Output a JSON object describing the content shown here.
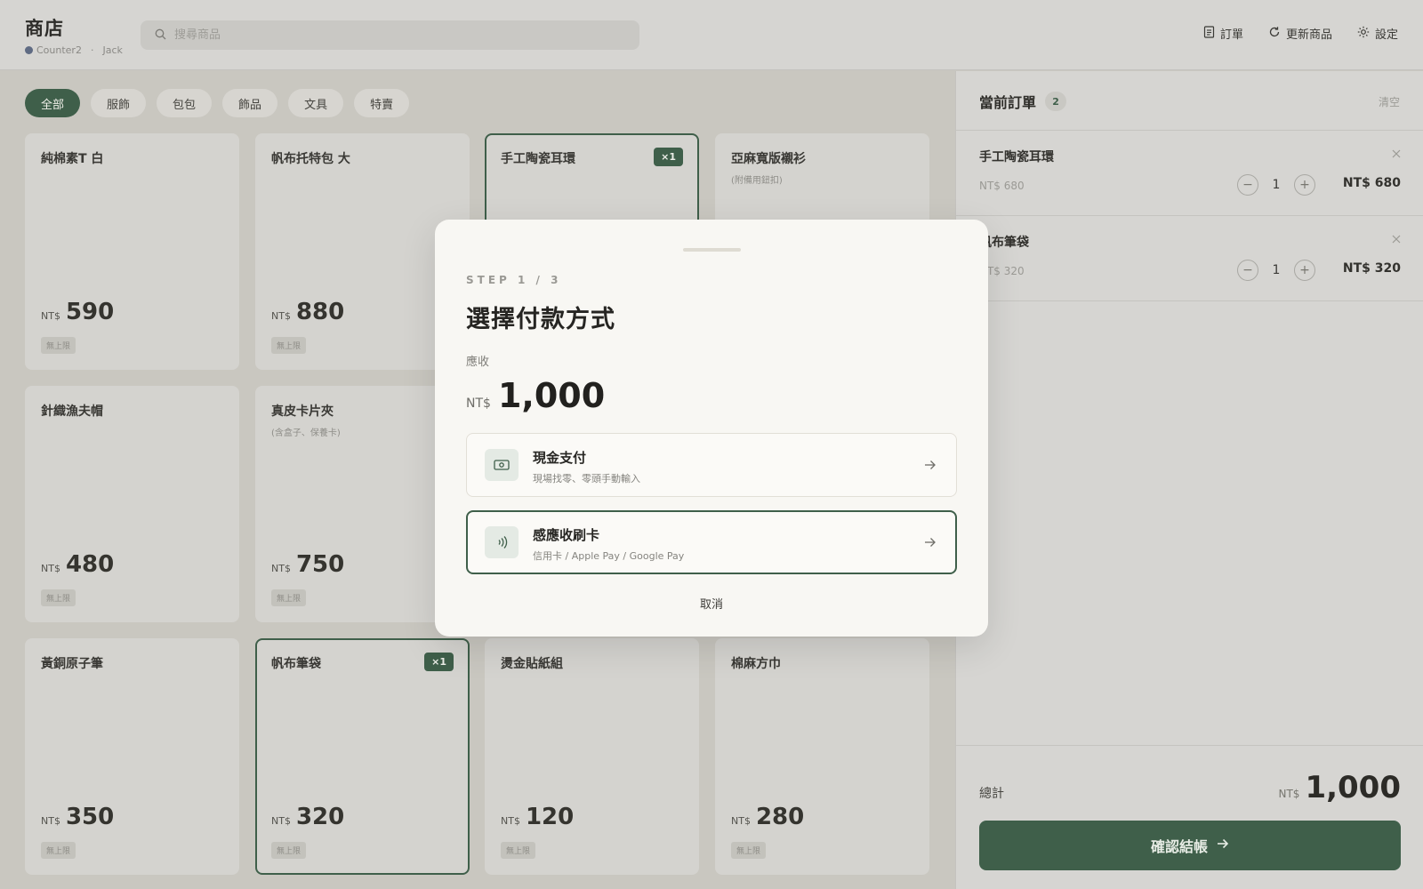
{
  "header": {
    "title": "商店",
    "device": "Counter2",
    "separator": "·",
    "user": "Jack",
    "search_placeholder": "搜尋商品",
    "actions": [
      {
        "label": "訂單",
        "icon": "orders-icon"
      },
      {
        "label": "更新商品",
        "icon": "refresh-icon"
      },
      {
        "label": "設定",
        "icon": "gear-icon"
      }
    ]
  },
  "filters": [
    "全部",
    "服飾",
    "包包",
    "飾品",
    "文具",
    "特賣"
  ],
  "active_filter": "全部",
  "products": [
    {
      "name": "純棉素T 白",
      "note": "",
      "currency": "NT$",
      "price": "590",
      "badge": "無上限",
      "qty": ""
    },
    {
      "name": "帆布托特包 大",
      "note": "",
      "currency": "NT$",
      "price": "880",
      "badge": "無上限",
      "qty": ""
    },
    {
      "name": "手工陶瓷耳環",
      "note": "",
      "currency": "NT$",
      "price": "",
      "badge": "",
      "qty": "×1"
    },
    {
      "name": "亞麻寬版襯衫",
      "note": "(附備用鈕扣)",
      "currency": "NT$",
      "price": "",
      "badge": "",
      "qty": ""
    },
    {
      "name": "針織漁夫帽",
      "note": "",
      "currency": "NT$",
      "price": "480",
      "badge": "無上限",
      "qty": ""
    },
    {
      "name": "真皮卡片夾",
      "note": "(含盒子、保養卡)",
      "currency": "NT$",
      "price": "750",
      "badge": "無上限",
      "qty": ""
    },
    {
      "name": "黃銅原子筆",
      "note": "",
      "currency": "NT$",
      "price": "350",
      "badge": "無上限",
      "qty": ""
    },
    {
      "name": "帆布筆袋",
      "note": "",
      "currency": "NT$",
      "price": "320",
      "badge": "無上限",
      "qty": "×1"
    },
    {
      "name": "燙金貼紙組",
      "note": "",
      "currency": "NT$",
      "price": "120",
      "badge": "無上限",
      "qty": ""
    },
    {
      "name": "棉麻方巾",
      "note": "",
      "currency": "NT$",
      "price": "280",
      "badge": "無上限",
      "qty": ""
    }
  ],
  "order": {
    "title": "當前訂單",
    "count": "2",
    "clear_label": "清空",
    "items": [
      {
        "name": "手工陶瓷耳環",
        "unit": "NT$ 680",
        "qty": "1",
        "total": "NT$ 680"
      },
      {
        "name": "帆布筆袋",
        "unit": "NT$ 320",
        "qty": "1",
        "total": "NT$ 320"
      }
    ],
    "total_label": "總計",
    "total_currency": "NT$",
    "total_amount": "1,000",
    "checkout_label": "確認結帳"
  },
  "modal": {
    "step": "STEP 1 / 3",
    "title": "選擇付款方式",
    "due_label": "應收",
    "due_currency": "NT$",
    "due_amount": "1,000",
    "options": [
      {
        "title": "現金支付",
        "subtitle": "現場找零、零頭手動輸入",
        "icon": "cash-icon"
      },
      {
        "title": "感應收刷卡",
        "subtitle": "信用卡 / Apple Pay / Google Pay",
        "icon": "contactless-icon"
      }
    ],
    "cancel_label": "取消"
  },
  "colors": {
    "accent": "#3f5f4a",
    "background": "#c9c7c0",
    "panel": "#d6d5d2",
    "modal": "#f8f7f3"
  }
}
